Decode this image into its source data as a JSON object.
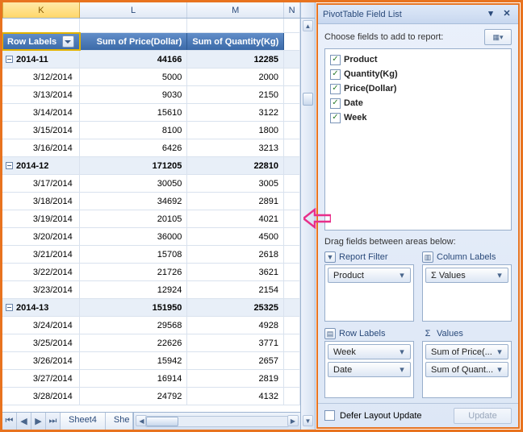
{
  "columns": {
    "K": "K",
    "L": "L",
    "M": "M",
    "N": "N"
  },
  "headers": {
    "row_labels": "Row Labels",
    "sum_price": "Sum of Price(Dollar)",
    "sum_qty": "Sum of Quantity(Kg)"
  },
  "groups": [
    {
      "label": "2014-11",
      "sum_price": "44166",
      "sum_qty": "12285",
      "rows": [
        {
          "date": "3/12/2014",
          "price": "5000",
          "qty": "2000"
        },
        {
          "date": "3/13/2014",
          "price": "9030",
          "qty": "2150"
        },
        {
          "date": "3/14/2014",
          "price": "15610",
          "qty": "3122"
        },
        {
          "date": "3/15/2014",
          "price": "8100",
          "qty": "1800"
        },
        {
          "date": "3/16/2014",
          "price": "6426",
          "qty": "3213"
        }
      ]
    },
    {
      "label": "2014-12",
      "sum_price": "171205",
      "sum_qty": "22810",
      "rows": [
        {
          "date": "3/17/2014",
          "price": "30050",
          "qty": "3005"
        },
        {
          "date": "3/18/2014",
          "price": "34692",
          "qty": "2891"
        },
        {
          "date": "3/19/2014",
          "price": "20105",
          "qty": "4021"
        },
        {
          "date": "3/20/2014",
          "price": "36000",
          "qty": "4500"
        },
        {
          "date": "3/21/2014",
          "price": "15708",
          "qty": "2618"
        },
        {
          "date": "3/22/2014",
          "price": "21726",
          "qty": "3621"
        },
        {
          "date": "3/23/2014",
          "price": "12924",
          "qty": "2154"
        }
      ]
    },
    {
      "label": "2014-13",
      "sum_price": "151950",
      "sum_qty": "25325",
      "rows": [
        {
          "date": "3/24/2014",
          "price": "29568",
          "qty": "4928"
        },
        {
          "date": "3/25/2014",
          "price": "22626",
          "qty": "3771"
        },
        {
          "date": "3/26/2014",
          "price": "15942",
          "qty": "2657"
        },
        {
          "date": "3/27/2014",
          "price": "16914",
          "qty": "2819"
        },
        {
          "date": "3/28/2014",
          "price": "24792",
          "qty": "4132"
        }
      ]
    }
  ],
  "tabs": {
    "sheet4": "Sheet4",
    "sheet_trunc": "She"
  },
  "field_list": {
    "title": "PivotTable Field List",
    "choose_label": "Choose fields to add to report:",
    "fields": {
      "product": "Product",
      "quantity": "Quantity(Kg)",
      "price": "Price(Dollar)",
      "date": "Date",
      "week": "Week"
    },
    "drag_label": "Drag fields between areas below:",
    "areas": {
      "report_filter": "Report Filter",
      "column_labels": "Column Labels",
      "row_labels": "Row Labels",
      "values": "Values"
    },
    "pills": {
      "product": "Product",
      "values": "Values",
      "week": "Week",
      "date": "Date",
      "sum_price": "Sum of Price(...",
      "sum_qty": "Sum of Quant..."
    },
    "sigma": "Σ",
    "footer": {
      "defer": "Defer Layout Update",
      "update": "Update"
    }
  }
}
